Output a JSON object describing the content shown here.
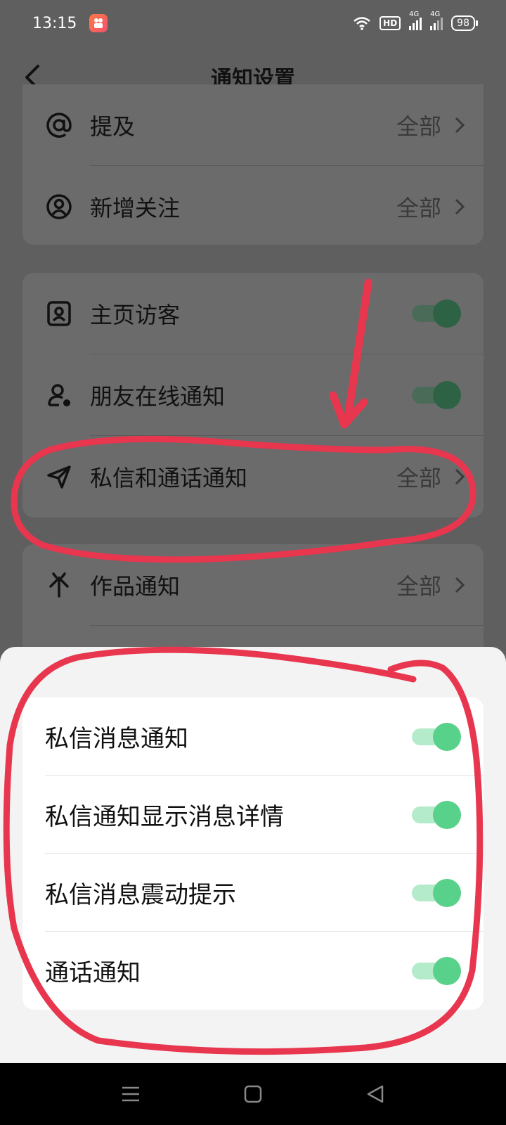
{
  "status_bar": {
    "time": "13:15",
    "hd_label": "HD",
    "net1": "4G",
    "net2": "4G",
    "battery": "98"
  },
  "header": {
    "title": "通知设置"
  },
  "card1": {
    "items": [
      {
        "label": "提及",
        "value": "全部",
        "icon": "at-icon"
      },
      {
        "label": "新增关注",
        "value": "全部",
        "icon": "user-circle-icon"
      }
    ]
  },
  "card2": {
    "items": [
      {
        "label": "主页访客",
        "icon": "profile-card-icon",
        "toggle": "on"
      },
      {
        "label": "朋友在线通知",
        "icon": "friend-online-icon",
        "toggle": "on"
      },
      {
        "label": "私信和通话通知",
        "value": "全部",
        "icon": "send-icon"
      }
    ]
  },
  "card3": {
    "items": [
      {
        "label": "作品通知",
        "value": "全部",
        "icon": "works-icon"
      }
    ]
  },
  "sheet": {
    "items": [
      {
        "label": "私信消息通知",
        "toggle": "on"
      },
      {
        "label": "私信通知显示消息详情",
        "toggle": "on"
      },
      {
        "label": "私信消息震动提示",
        "toggle": "on"
      },
      {
        "label": "通话通知",
        "toggle": "on"
      }
    ]
  },
  "colors": {
    "annotation": "#e8364f",
    "toggle_on": "#58d18a",
    "overlay_bg": "#5f5f5f"
  }
}
